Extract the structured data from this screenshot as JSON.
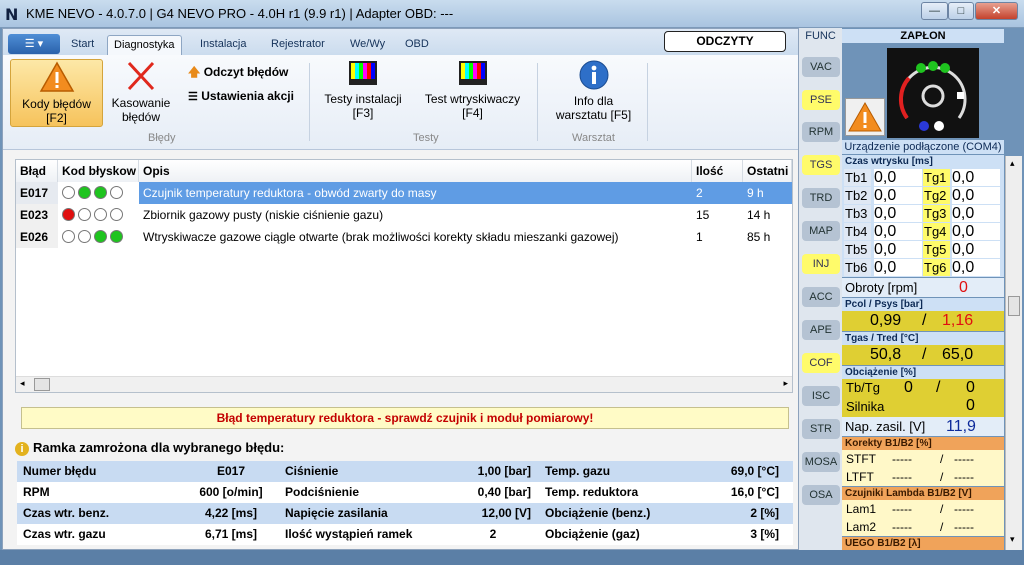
{
  "window": {
    "logo": "N",
    "title": "KME NEVO - 4.0.7.0  |  G4 NEVO PRO - 4.0H r1 (9.9 r1)  |  Adapter OBD: ---",
    "minimize": "—",
    "maximize": "□",
    "close": "✕"
  },
  "tabs": [
    "Start",
    "Diagnostyka",
    "Instalacja",
    "Rejestrator",
    "We/Wy",
    "OBD"
  ],
  "odczyty": "ODCZYTY",
  "ribbon": {
    "kody_l1": "Kody błędów",
    "kody_l2": "[F2]",
    "kas_l1": "Kasowanie",
    "kas_l2": "błędów",
    "odczyt": "Odczyt błędów",
    "ustawienia": "Ustawienia akcji",
    "group_bledy": "Błędy",
    "testy_inst_l1": "Testy instalacji",
    "testy_inst_l2": "[F3]",
    "testy_wtr_l1": "Test wtryskiwaczy",
    "testy_wtr_l2": "[F4]",
    "group_testy": "Testy",
    "info_l1": "Info dla",
    "info_l2": "warsztatu [F5]",
    "group_warsztat": "Warsztat"
  },
  "table": {
    "headers": [
      "Błąd",
      "Kod błyskow",
      "Opis",
      "Ilość",
      "Ostatni"
    ],
    "rows": [
      {
        "code": "E017",
        "desc": "Czujnik temperatury reduktora - obwód zwarty do masy",
        "count": "2",
        "last": "9 h"
      },
      {
        "code": "E023",
        "desc": "Zbiornik gazowy pusty (niskie ciśnienie gazu)",
        "count": "15",
        "last": "14 h"
      },
      {
        "code": "E026",
        "desc": "Wtryskiwacze gazowe ciągle otwarte (brak możliwości korekty składu mieszanki gazowej)",
        "count": "1",
        "last": "85 h"
      }
    ]
  },
  "message": "Błąd temperatury reduktora - sprawdź czujnik i moduł pomiarowy!",
  "frame_title": "Ramka zamrożona dla wybranego błędu:",
  "frame": [
    [
      "Numer błędu",
      "E017",
      "Ciśnienie",
      "1,00 [bar]",
      "Temp. gazu",
      "69,0 [°C]"
    ],
    [
      "RPM",
      "600 [o/min]",
      "Podciśnienie",
      "0,40 [bar]",
      "Temp. reduktora",
      "16,0 [°C]"
    ],
    [
      "Czas wtr. benz.",
      "4,22 [ms]",
      "Napięcie zasilania",
      "12,00 [V]",
      "Obciążenie (benz.)",
      "2 [%]"
    ],
    [
      "Czas wtr. gazu",
      "6,71 [ms]",
      "Ilość wystąpień ramek",
      "2",
      "Obciążenie (gaz)",
      "3 [%]"
    ]
  ],
  "sidenav": [
    "FUNC",
    "VAC",
    "PSE",
    "RPM",
    "TGS",
    "TRD",
    "MAP",
    "INJ",
    "ACC",
    "APE",
    "COF",
    "ISC",
    "STR",
    "MOSA",
    "OSA"
  ],
  "right": {
    "zaplon": "ZAPŁON",
    "status": "Urządzenie podłączone (COM4)",
    "czas_hdr": "Czas wtrysku [ms]",
    "tb": [
      "Tb1",
      "Tb2",
      "Tb3",
      "Tb4",
      "Tb5",
      "Tb6"
    ],
    "tg": [
      "Tg1",
      "Tg2",
      "Tg3",
      "Tg4",
      "Tg5",
      "Tg6"
    ],
    "tb_val": "0,0",
    "tg_val": "0,0",
    "obroty": "Obroty [rpm]",
    "obroty_val": "0",
    "pcol_hdr": "Pcol / Psys [bar]",
    "pcol": "0,99",
    "psys": "1,16",
    "tgas_hdr": "Tgas / Tred [°C]",
    "tgas": "50,8",
    "tred": "65,0",
    "obc_hdr": "Obciążenie [%]",
    "tbtg": "Tb/Tg",
    "tbtg_a": "0",
    "tbtg_b": "0",
    "silnika": "Silnika",
    "silnika_val": "0",
    "nap": "Nap. zasil. [V]",
    "nap_val": "11,9",
    "korekty_hdr": "Korekty B1/B2 [%]",
    "stft": "STFT",
    "ltft": "LTFT",
    "dash": "-----",
    "lambda_hdr": "Czujniki Lambda B1/B2 [V]",
    "lam1": "Lam1",
    "lam2": "Lam2",
    "uego_hdr": "UEGO B1/B2 [λ]",
    "slash": "/"
  }
}
